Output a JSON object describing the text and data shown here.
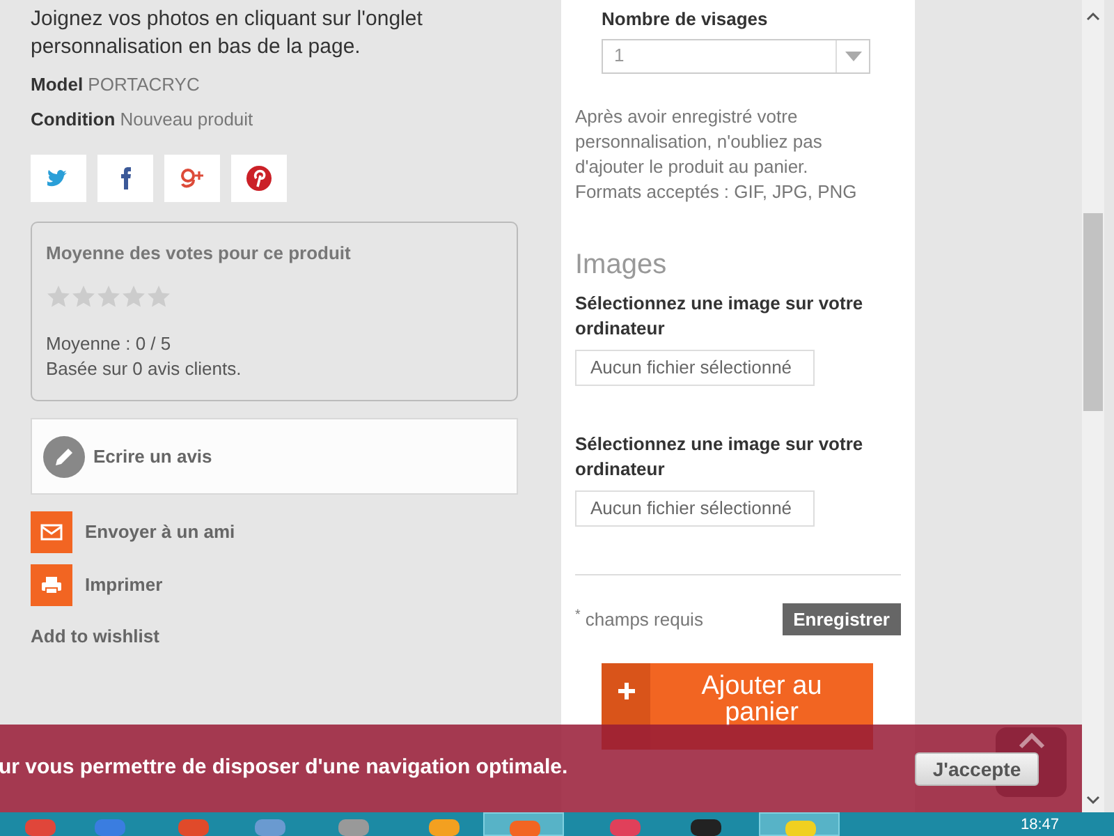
{
  "product": {
    "intro": "Joignez vos photos en cliquant sur l'onglet personnalisation en bas de la page.",
    "specs": [
      {
        "label": "Model",
        "value": "PORTACRYC"
      },
      {
        "label": "Condition",
        "value": "Nouveau produit"
      }
    ]
  },
  "social": [
    {
      "kind": "twitter"
    },
    {
      "kind": "facebook"
    },
    {
      "kind": "googleplus"
    },
    {
      "kind": "pinterest"
    }
  ],
  "rating": {
    "title": "Moyenne des votes pour ce produit",
    "stars": 0,
    "average": "Moyenne : 0 / 5",
    "based_on": "Basée sur 0 avis clients."
  },
  "write_review": "Ecrire un avis",
  "actions": [
    {
      "kind": "mail",
      "label": "Envoyer à un ami"
    },
    {
      "kind": "print",
      "label": "Imprimer"
    }
  ],
  "wishlist": "Add to wishlist",
  "customization": {
    "faces_label": "Nombre de visages",
    "faces_value": "1",
    "note": "Après avoir enregistré votre personnalisation, n'oubliez pas d'ajouter le produit au panier.",
    "formats": "Formats acceptés : GIF, JPG, PNG",
    "images_heading": "Images",
    "image_fields": [
      {
        "label": "Sélectionnez une image sur votre ordinateur",
        "file": "Aucun fichier sélectionné"
      },
      {
        "label": "Sélectionnez une image sur votre ordinateur",
        "file": "Aucun fichier sélectionné"
      }
    ],
    "required_note": "$^{*}$ champs requis",
    "save_button": "Enregistrer"
  },
  "add_to_cart": "Ajouter au panier",
  "cookie_banner": {
    "text": "ur vous permettre de disposer d'une navigation optimale.",
    "accept_button": "J'accepte"
  },
  "taskbar": {
    "apps": [
      {
        "selected": false
      },
      {
        "selected": false
      },
      {
        "selected": false
      },
      {
        "selected": false
      },
      {
        "selected": false
      },
      {
        "selected": false
      },
      {
        "selected": true
      },
      {
        "selected": false
      },
      {
        "selected": false
      },
      {
        "selected": true
      }
    ],
    "clock": "18:47"
  }
}
